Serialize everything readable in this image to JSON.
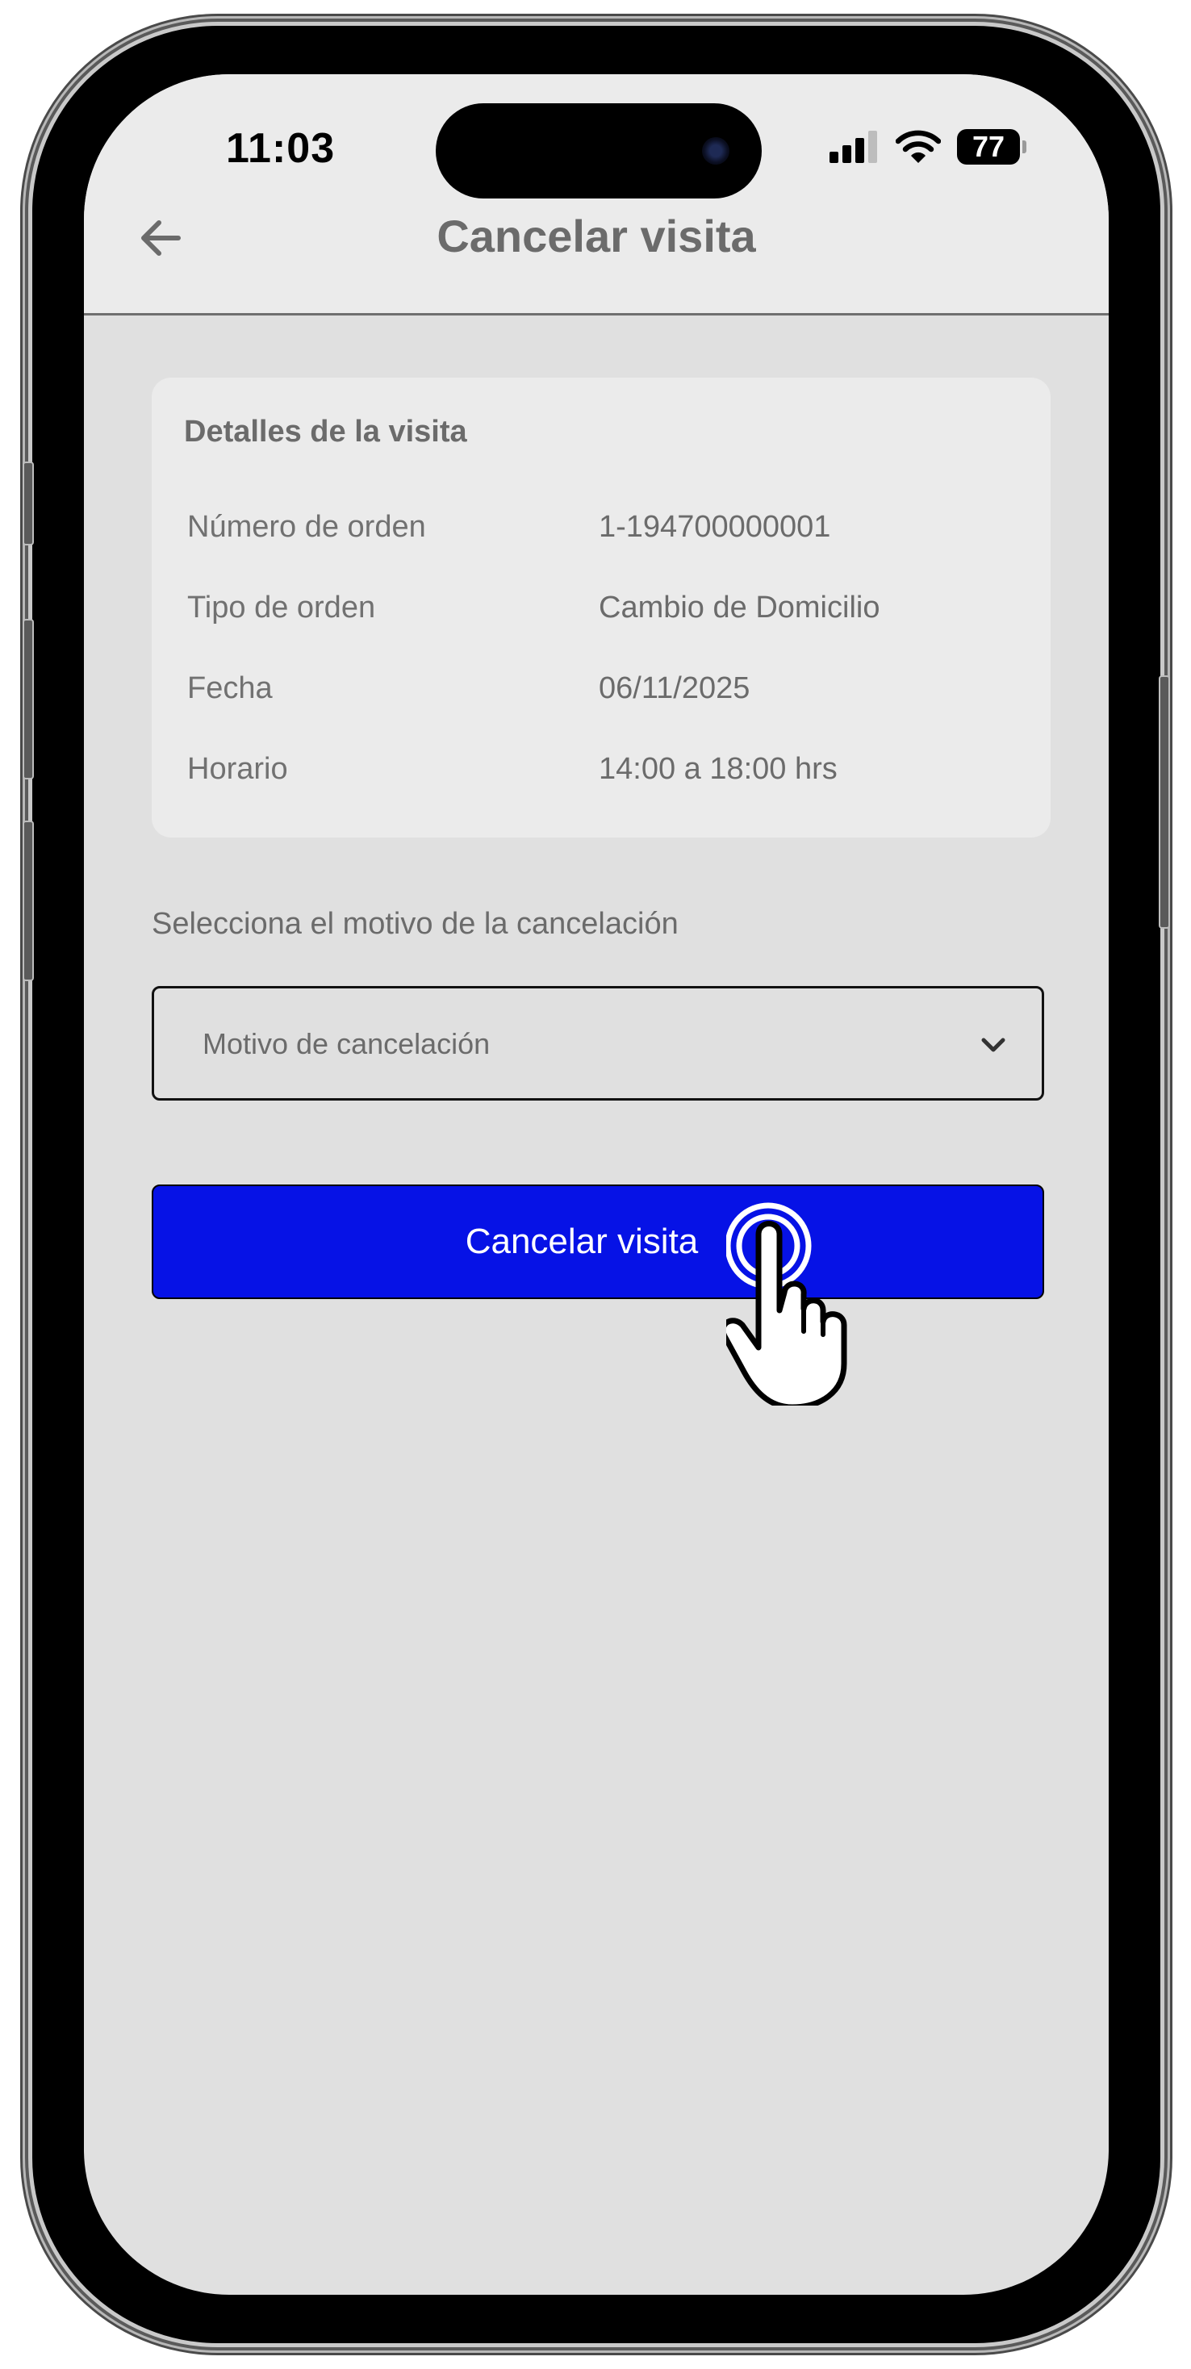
{
  "status_bar": {
    "time": "11:03",
    "battery": "77"
  },
  "header": {
    "title": "Cancelar visita"
  },
  "details": {
    "title": "Detalles de la visita",
    "rows": [
      {
        "label": "Número de orden",
        "value": "1-194700000001"
      },
      {
        "label": "Tipo de orden",
        "value": "Cambio de Domicilio"
      },
      {
        "label": "Fecha",
        "value": "06/11/2025"
      },
      {
        "label": "Horario",
        "value": "14:00 a 18:00 hrs"
      }
    ]
  },
  "reason": {
    "label": "Selecciona el motivo de la cancelación",
    "placeholder": "Motivo de cancelación"
  },
  "actions": {
    "cancel_label": "Cancelar visita"
  },
  "colors": {
    "primary": "#0612e6",
    "background": "#e0e0e0",
    "card": "#ebebeb",
    "text": "#6b6b6b"
  },
  "icons": [
    "back-arrow-icon",
    "signal-icon",
    "wifi-icon",
    "battery-icon",
    "chevron-down-icon",
    "pointer-hand-icon"
  ]
}
